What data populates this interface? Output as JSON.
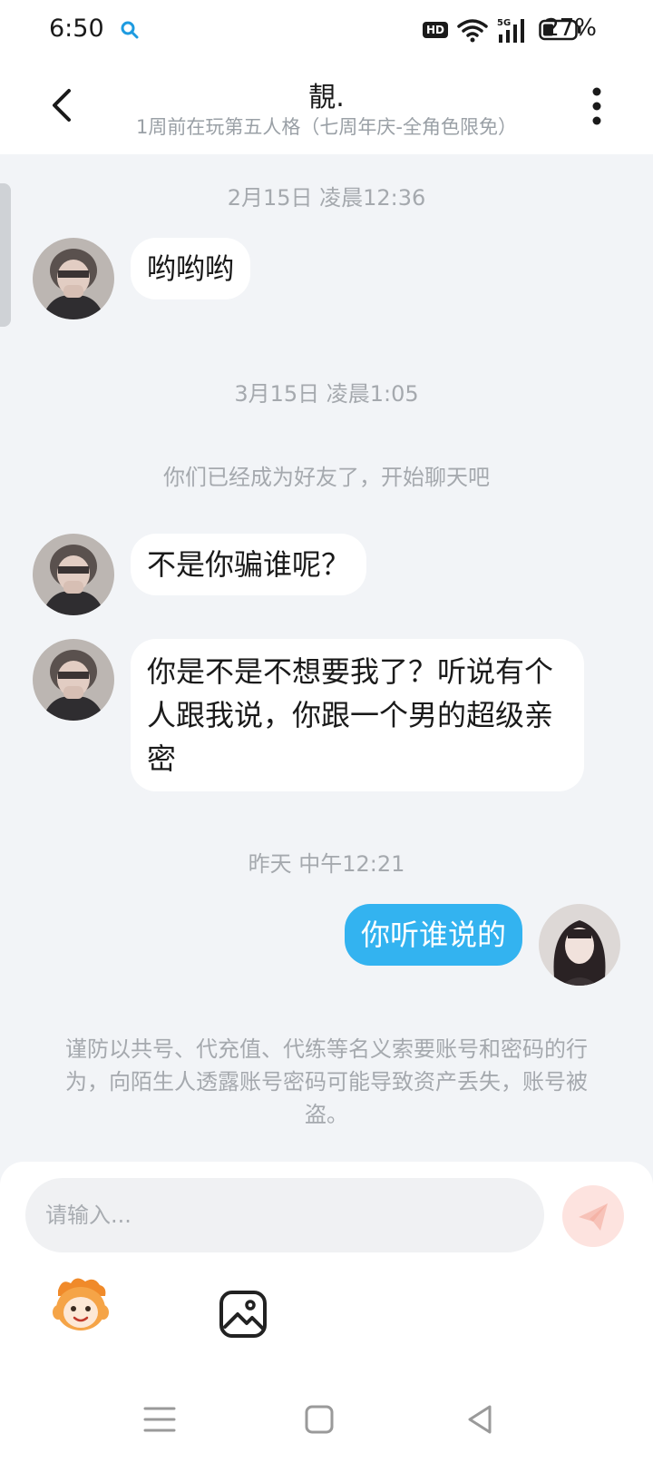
{
  "status_bar": {
    "time": "6:50",
    "network_badge": "HD",
    "signal_label": "5G",
    "battery": "27%"
  },
  "header": {
    "title": "靚.",
    "subtitle": "1周前在玩第五人格（七周年庆-全角色限免）"
  },
  "messages": {
    "ts1": "2月15日 凌晨12:36",
    "m1": "哟哟哟",
    "ts2": "3月15日 凌晨1:05",
    "system": "你们已经成为好友了，开始聊天吧",
    "m2": "不是你骗谁呢？",
    "m3": "你是不是不想要我了？听说有个人跟我说，你跟一个男的超级亲密",
    "ts3": "昨天 中午12:21",
    "m4": "你听谁说的"
  },
  "notice": "谨防以共号、代充值、代练等名义索要账号和密码的行为，向陌生人透露账号密码可能导致资产丢失，账号被盗。",
  "composer": {
    "placeholder": "请输入..."
  },
  "colors": {
    "my_bubble": "#33b3f0",
    "send_button": "#fde3df",
    "background": "#f2f4f7"
  },
  "icons": [
    "search-icon",
    "wifi-icon",
    "signal-icon",
    "battery-icon",
    "back-arrow-icon",
    "more-vertical-icon",
    "send-icon",
    "emoji-mascot-icon",
    "image-icon",
    "menu-icon",
    "home-icon",
    "back-triangle-icon"
  ]
}
